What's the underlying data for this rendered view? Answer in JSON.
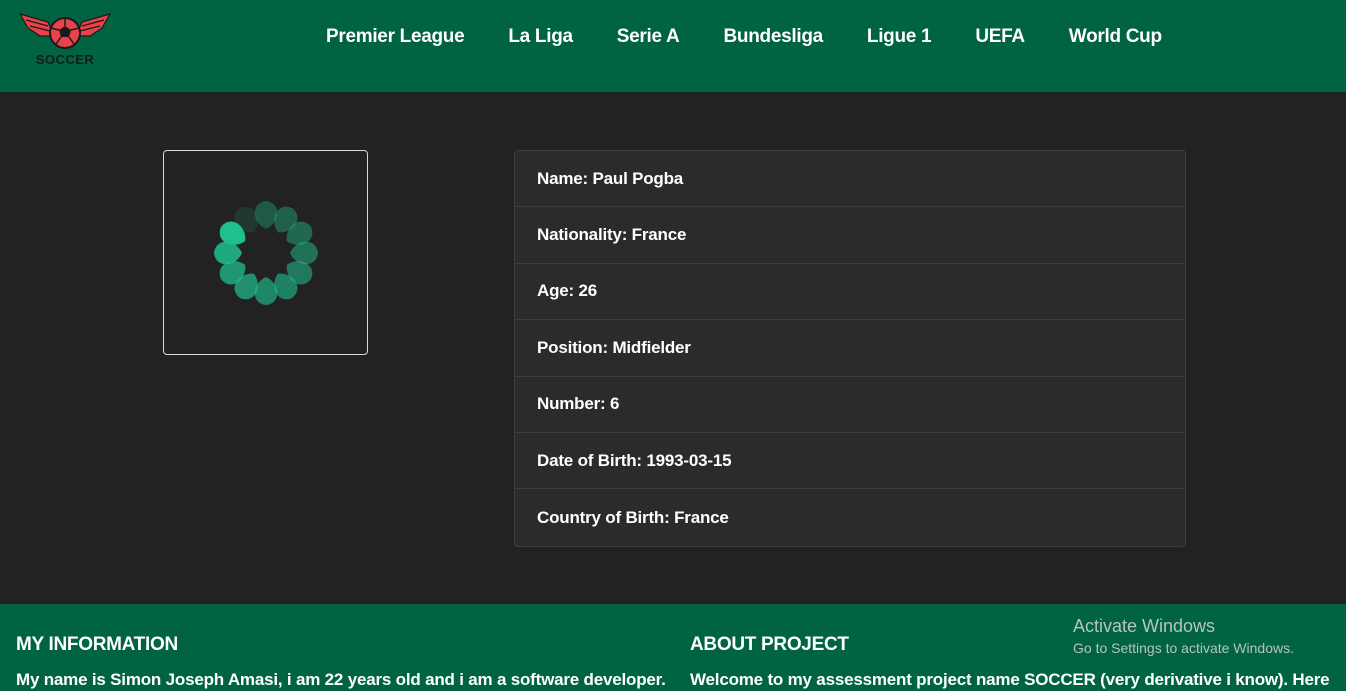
{
  "navbar": {
    "logo_text": "SOCCER",
    "links": [
      "Premier League",
      "La Liga",
      "Serie A",
      "Bundesliga",
      "Ligue 1",
      "UEFA",
      "World Cup"
    ]
  },
  "player": {
    "photo_icon": "loading-spinner-icon",
    "fields": [
      "Name: Paul Pogba",
      "Nationality: France",
      "Age: 26",
      "Position: Midfielder",
      "Number: 6",
      "Date of Birth: 1993-03-15",
      "Country of Birth: France"
    ]
  },
  "footer": {
    "my_info_heading": "MY INFORMATION",
    "my_info_text": "My name is Simon Joseph Amasi, i am 22 years old and i am a software developer.",
    "about_heading": "ABOUT PROJECT",
    "about_text": "Welcome to my assessment project name SOCCER (very derivative i know). Here"
  },
  "windows_watermark": {
    "title": "Activate Windows",
    "subtitle": "Go to Settings to activate Windows."
  },
  "colors": {
    "nav_bg": "#006341",
    "page_bg": "#222222",
    "card_bg": "#2b2b2b",
    "spinner": "#1fbf8f",
    "logo_red": "#e8424a"
  }
}
